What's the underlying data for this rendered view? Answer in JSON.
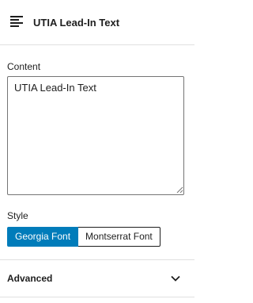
{
  "block": {
    "icon": "paragraph-align-left-icon",
    "title": "UTIA Lead-In Text"
  },
  "content": {
    "label": "Content",
    "value": "UTIA Lead-In Text"
  },
  "style": {
    "label": "Style",
    "options": [
      "Georgia Font",
      "Montserrat Font"
    ],
    "selected": "Georgia Font",
    "accent_color": "#007cba"
  },
  "advanced": {
    "label": "Advanced",
    "icon": "chevron-down-icon"
  }
}
